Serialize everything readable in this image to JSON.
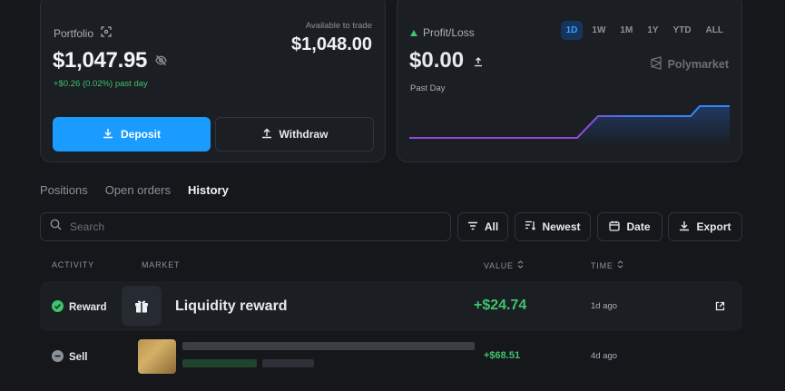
{
  "portfolio": {
    "label": "Portfolio",
    "value": "$1,047.95",
    "change": "+$0.26 (0.02%) past day",
    "available_label": "Available to trade",
    "available_value": "$1,048.00",
    "deposit_label": "Deposit",
    "withdraw_label": "Withdraw"
  },
  "pnl": {
    "label": "Profit/Loss",
    "value": "$0.00",
    "period_label": "Past Day",
    "brand": "Polymarket",
    "ranges": [
      "1D",
      "1W",
      "1M",
      "1Y",
      "YTD",
      "ALL"
    ],
    "active_range": "1D"
  },
  "tabs": [
    "Positions",
    "Open orders",
    "History"
  ],
  "active_tab": "History",
  "search": {
    "placeholder": "Search"
  },
  "filters": {
    "all": "All",
    "sort": "Newest",
    "date": "Date",
    "export": "Export"
  },
  "table": {
    "headers": {
      "activity": "ACTIVITY",
      "market": "MARKET",
      "value": "VALUE",
      "time": "TIME"
    },
    "rows": [
      {
        "activity": "Reward",
        "market": "Liquidity reward",
        "value": "+$24.74",
        "time": "1d ago"
      },
      {
        "activity": "Sell",
        "market": "",
        "value": "+$68.51",
        "time": "4d ago"
      }
    ]
  },
  "colors": {
    "accent": "#1a9bff",
    "positive": "#3ec46d",
    "background": "#15171b",
    "card": "#1b1e23"
  }
}
